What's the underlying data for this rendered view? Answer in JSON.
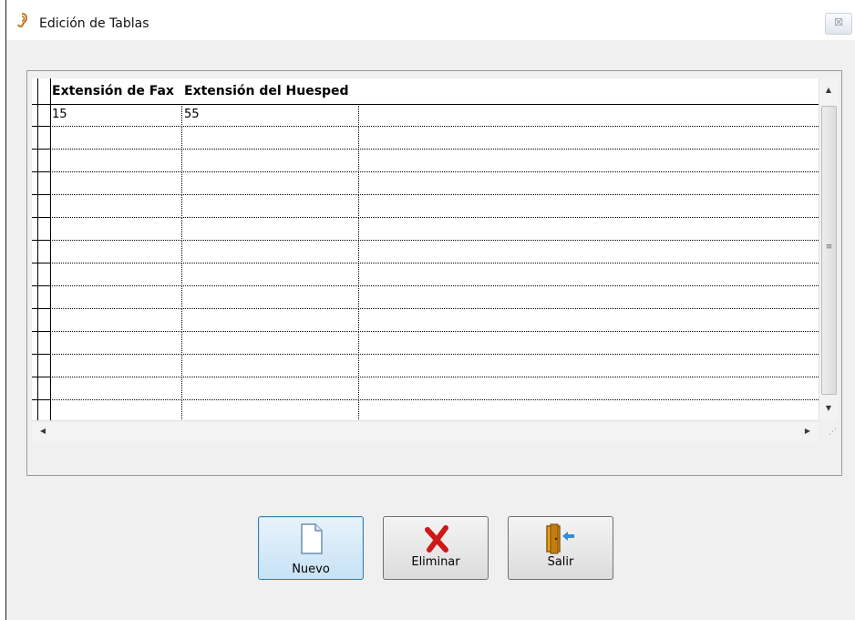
{
  "window": {
    "title": "Edición de Tablas",
    "close_glyph": "☒"
  },
  "grid": {
    "columns": [
      "Extensión de Fax",
      "Extensión del Huesped"
    ],
    "rows": [
      [
        "15",
        "55"
      ],
      [
        "",
        ""
      ],
      [
        "",
        ""
      ],
      [
        "",
        ""
      ],
      [
        "",
        ""
      ],
      [
        "",
        ""
      ],
      [
        "",
        ""
      ],
      [
        "",
        ""
      ],
      [
        "",
        ""
      ],
      [
        "",
        ""
      ],
      [
        "",
        ""
      ],
      [
        "",
        ""
      ],
      [
        "",
        ""
      ],
      [
        "",
        ""
      ]
    ]
  },
  "scrollbars": {
    "up": "▲",
    "down": "▼",
    "left": "◀",
    "right": "▶",
    "grip": "≡",
    "corner": "⋰"
  },
  "buttons": {
    "nuevo": "Nuevo",
    "eliminar": "Eliminar",
    "salir": "Salir"
  },
  "icons": {
    "title": "ear-icon",
    "nuevo": "new-document-icon",
    "eliminar": "red-x-delete-icon",
    "salir": "exit-door-icon"
  }
}
